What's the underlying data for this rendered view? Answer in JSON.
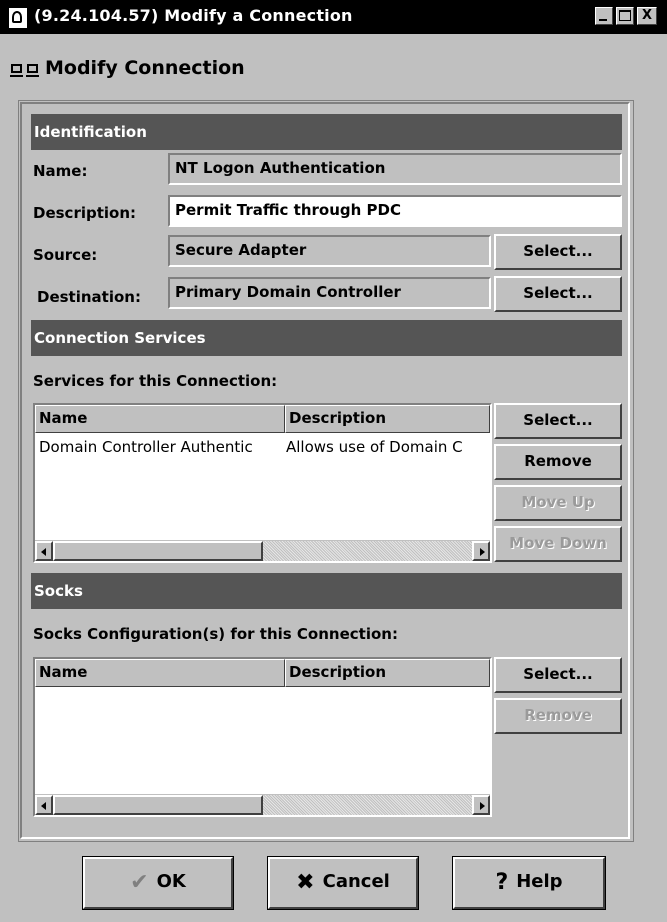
{
  "window": {
    "title": "(9.24.104.57) Modify a Connection",
    "controls": {
      "minimize": "",
      "maximize": "",
      "close": "X"
    }
  },
  "header": {
    "title": "Modify Connection"
  },
  "identification": {
    "section_title": "Identification",
    "name_label": "Name:",
    "name_value": "NT Logon Authentication",
    "description_label": "Description:",
    "description_value": "Permit Traffic through PDC",
    "source_label": "Source:",
    "source_value": "Secure Adapter",
    "source_select": "Select...",
    "destination_label": "Destination:",
    "destination_value": "Primary Domain Controller",
    "destination_select": "Select..."
  },
  "services": {
    "section_title": "Connection Services",
    "list_label": "Services for this Connection:",
    "columns": [
      "Name",
      "Description"
    ],
    "rows": [
      {
        "name": "Domain Controller Authentic",
        "description": "Allows use of Domain C"
      }
    ],
    "buttons": {
      "select": "Select...",
      "remove": "Remove",
      "move_up": "Move Up",
      "move_down": "Move Down"
    }
  },
  "socks": {
    "section_title": "Socks",
    "list_label": "Socks Configuration(s) for this Connection:",
    "columns": [
      "Name",
      "Description"
    ],
    "rows": [],
    "buttons": {
      "select": "Select...",
      "remove": "Remove"
    }
  },
  "footer": {
    "ok": "OK",
    "cancel": "Cancel",
    "help": "Help"
  },
  "icons": {
    "ok": "checkmark-icon",
    "cancel": "x-icon",
    "help": "question-icon",
    "header": "network-connection-icon",
    "app": "app-icon"
  },
  "colors": {
    "titlebar": "#000000",
    "section": "#555555",
    "dialog": "#c0c0c0",
    "disabled": "#9a9a9a"
  }
}
